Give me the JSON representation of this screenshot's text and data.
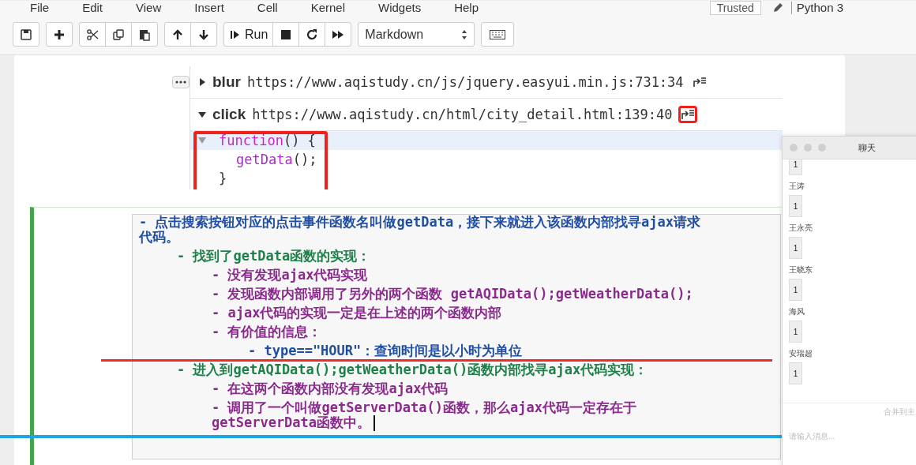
{
  "menu": [
    "File",
    "Edit",
    "View",
    "Insert",
    "Cell",
    "Kernel",
    "Widgets",
    "Help"
  ],
  "trusted": "Trusted",
  "kernel": "Python 3",
  "toolbar": [
    [
      {
        "kind": "save"
      }
    ],
    [
      {
        "kind": "add"
      }
    ],
    [
      {
        "kind": "cut"
      },
      {
        "kind": "copy"
      },
      {
        "kind": "paste"
      }
    ],
    [
      {
        "kind": "up"
      },
      {
        "kind": "down"
      }
    ],
    [
      {
        "kind": "run",
        "label": "Run"
      },
      {
        "kind": "stop"
      },
      {
        "kind": "restart"
      },
      {
        "kind": "run-all"
      }
    ]
  ],
  "cell_type": "Markdown",
  "listeners": [
    {
      "event": "blur",
      "location": "https://www.aqistudy.cn/js/jquery.easyui.min.js:731:34",
      "expanded": false,
      "highlighted": false
    },
    {
      "event": "click",
      "location": "https://www.aqistudy.cn/html/city_detail.html:139:40",
      "expanded": true,
      "highlighted": true
    }
  ],
  "handler_code": {
    "highlighted": true,
    "lines": [
      {
        "tokens": [
          {
            "t": "function",
            "kind": "keyword"
          },
          {
            "t": "() {",
            "kind": "plain"
          }
        ],
        "children": [
          {
            "tokens": [
              {
                "t": "getData",
                "kind": "call"
              },
              {
                "t": "();",
                "kind": "plain"
              }
            ]
          }
        ]
      },
      {
        "tokens": [
          {
            "t": "}",
            "kind": "plain"
          }
        ]
      }
    ]
  },
  "notes": [
    {
      "text": "- 点击搜索按钮对应的点击事件函数名叫做getData，接下来就进入该函数内部找寻ajax请求代码。",
      "children": [
        {
          "text": "- 找到了getData函数的实现：",
          "children": [
            {
              "text": "- 没有发现ajax代码实现"
            },
            {
              "text": "- 发现函数内部调用了另外的两个函数 getAQIData();getWeatherData();"
            },
            {
              "text": "- ajax代码的实现一定是在上述的两个函数内部"
            },
            {
              "text": "- 有价值的信息：",
              "children": [
                {
                  "text": "- type==\"HOUR\"：查询时间是以小时为单位"
                }
              ]
            }
          ]
        },
        {
          "text": "- 进入到getAQIData();getWeatherData()函数内部找寻ajax代码实现：",
          "children": [
            {
              "text": "- 在这两个函数内部没有发现ajax代码"
            },
            {
              "text": "- 调用了一个叫做getServerData()函数，那么ajax代码一定存在于getServerData函数中。"
            }
          ]
        }
      ]
    }
  ],
  "chat": {
    "title": "聊天",
    "messages": [
      {
        "text": "1"
      },
      {
        "sender": "王涛",
        "text": "1"
      },
      {
        "sender": "王永亮",
        "text": "1"
      },
      {
        "sender": "王晓东",
        "text": "1"
      },
      {
        "sender": "海风",
        "text": "1"
      },
      {
        "sender": "安瑞超",
        "text": "1"
      }
    ],
    "merge_button": "合并到主",
    "placeholder": "请输入消息..."
  }
}
